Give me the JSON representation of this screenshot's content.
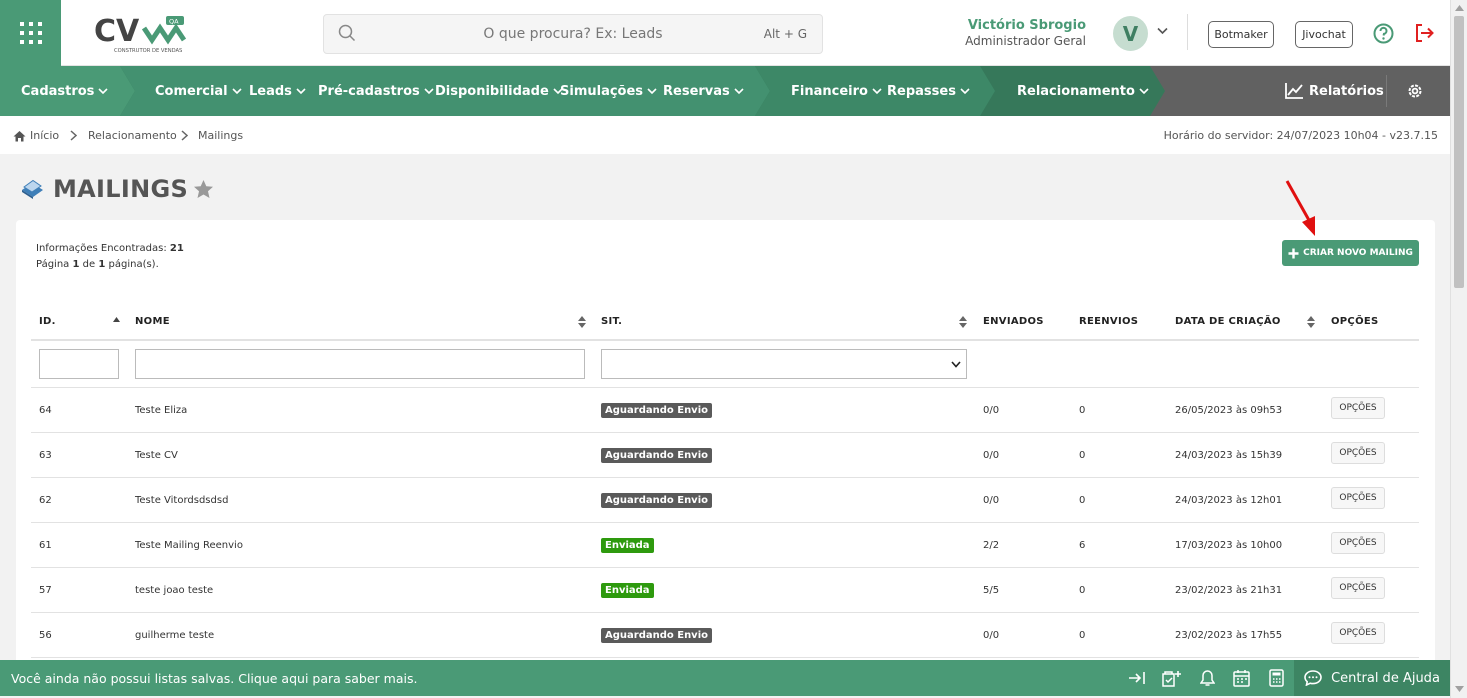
{
  "header": {
    "logo_text": "CV",
    "logo_badge": "QA",
    "logo_sub": "CONSTRUTOR DE VENDAS",
    "search_placeholder": "O que procura? Ex: Leads",
    "search_shortcut": "Alt + G",
    "user_name": "Victório Sbrogio",
    "user_role": "Administrador Geral",
    "avatar_letter": "V",
    "botmaker_label": "Botmaker",
    "jivochat_label": "Jivochat"
  },
  "nav": {
    "items": [
      "Cadastros",
      "Comercial",
      "Leads",
      "Pré-cadastros",
      "Disponibilidade",
      "Simulações",
      "Reservas",
      "Financeiro",
      "Repasses",
      "Relacionamento"
    ],
    "reports_label": "Relatórios"
  },
  "breadcrumb": {
    "items": [
      "Início",
      "Relacionamento",
      "Mailings"
    ],
    "server_time": "Horário do servidor: 24/07/2023 10h04 - v23.7.15"
  },
  "page": {
    "title": "MAILINGS",
    "info_found_label": "Informações Encontradas:",
    "info_found_value": "21",
    "page_pre": "Página",
    "page_num": "1",
    "page_mid": "de",
    "page_total": "1",
    "page_post": "página(s).",
    "new_button": "CRIAR NOVO MAILING"
  },
  "table": {
    "headers": [
      "ID.",
      "NOME",
      "SIT.",
      "ENVIADOS",
      "REENVIOS",
      "DATA DE CRIAÇÃO",
      "OPÇÕES"
    ],
    "option_label": "OPÇÕES",
    "rows": [
      {
        "id": "64",
        "name": "Teste Eliza",
        "status": "Aguardando Envio",
        "sent": "0/0",
        "resends": "0",
        "date": "26/05/2023 às 09h53"
      },
      {
        "id": "63",
        "name": "Teste CV",
        "status": "Aguardando Envio",
        "sent": "0/0",
        "resends": "0",
        "date": "24/03/2023 às 15h39"
      },
      {
        "id": "62",
        "name": "Teste Vitordsdsdsd",
        "status": "Aguardando Envio",
        "sent": "0/0",
        "resends": "0",
        "date": "24/03/2023 às 12h01"
      },
      {
        "id": "61",
        "name": "Teste Mailing Reenvio",
        "status": "Enviada",
        "sent": "2/2",
        "resends": "6",
        "date": "17/03/2023 às 10h00"
      },
      {
        "id": "57",
        "name": "teste joao teste",
        "status": "Enviada",
        "sent": "5/5",
        "resends": "0",
        "date": "23/02/2023 às 21h31"
      },
      {
        "id": "56",
        "name": "guilherme teste",
        "status": "Aguardando Envio",
        "sent": "0/0",
        "resends": "0",
        "date": "23/02/2023 às 17h55"
      }
    ]
  },
  "footer": {
    "message": "Você ainda não possui listas salvas. Clique aqui para saber mais.",
    "help_center": "Central de Ajuda"
  },
  "colors": {
    "brand_green": "#4a9a76",
    "nav_dark": "#616161",
    "status_waiting": "#5a5a5a",
    "status_sent": "#2e9a0e",
    "arrow_red": "#e01010"
  }
}
